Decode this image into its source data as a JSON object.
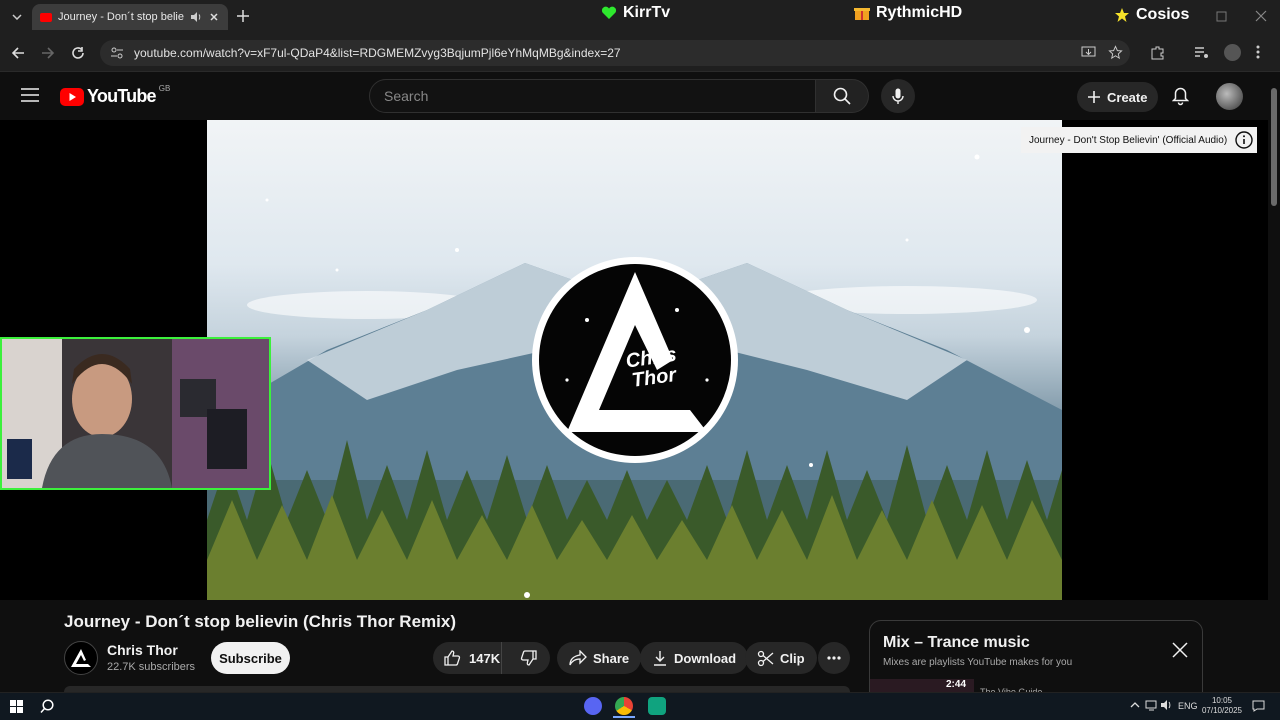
{
  "browser": {
    "tab_title": "Journey - Don´t stop believin",
    "url": "youtube.com/watch?v=xF7ul-QDaP4&list=RDGMEMZvyg3BqjumPjl6eYhMqMBg&index=27",
    "streams": [
      {
        "label": "KirrTv",
        "icon": "green-heart-icon"
      },
      {
        "label": "RythmicHD",
        "icon": "gift-icon"
      },
      {
        "label": "Cosios",
        "icon": "star-icon"
      }
    ]
  },
  "youtube": {
    "logo_text": "YouTube",
    "region": "GB",
    "search_placeholder": "Search",
    "create_label": "Create"
  },
  "player": {
    "info_tooltip": "Journey - Don't Stop Believin' (Official Audio)",
    "logo_text_line1": "Chris",
    "logo_text_line2": "Thor"
  },
  "video": {
    "title": "Journey - Don´t stop believin (Chris Thor Remix)",
    "channel_name": "Chris Thor",
    "subscribers": "22.7K subscribers",
    "subscribe_label": "Subscribe",
    "likes": "147K",
    "share_label": "Share",
    "download_label": "Download",
    "clip_label": "Clip"
  },
  "mix": {
    "title": "Mix – Trance music",
    "subtitle": "Mixes are playlists YouTube makes for you",
    "peek_duration": "2:44",
    "peek_channel": "The Vibe Guide"
  },
  "taskbar": {
    "language": "ENG",
    "time": "10:05",
    "date": "07/10/2025"
  },
  "colors": {
    "accent_red": "#ff0000",
    "webcam_border": "#3cf03c",
    "background": "#0f0f0f"
  }
}
